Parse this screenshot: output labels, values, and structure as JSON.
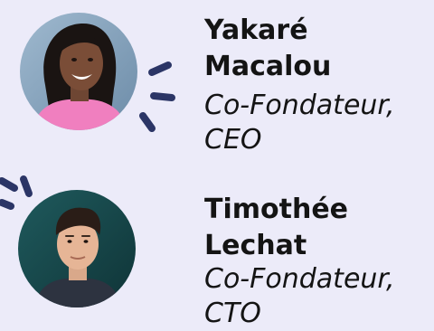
{
  "team": [
    {
      "first_name": "Yakaré",
      "last_name": "Macalou",
      "role_line1": "Co-Fondateur,",
      "role_line2": "CEO"
    },
    {
      "first_name": "Timothée",
      "last_name": "Lechat",
      "role_line1": "Co-Fondateur,",
      "role_line2": "CTO"
    }
  ],
  "colors": {
    "background": "#ecebf9",
    "text": "#141414",
    "accent": "#2b3566"
  }
}
